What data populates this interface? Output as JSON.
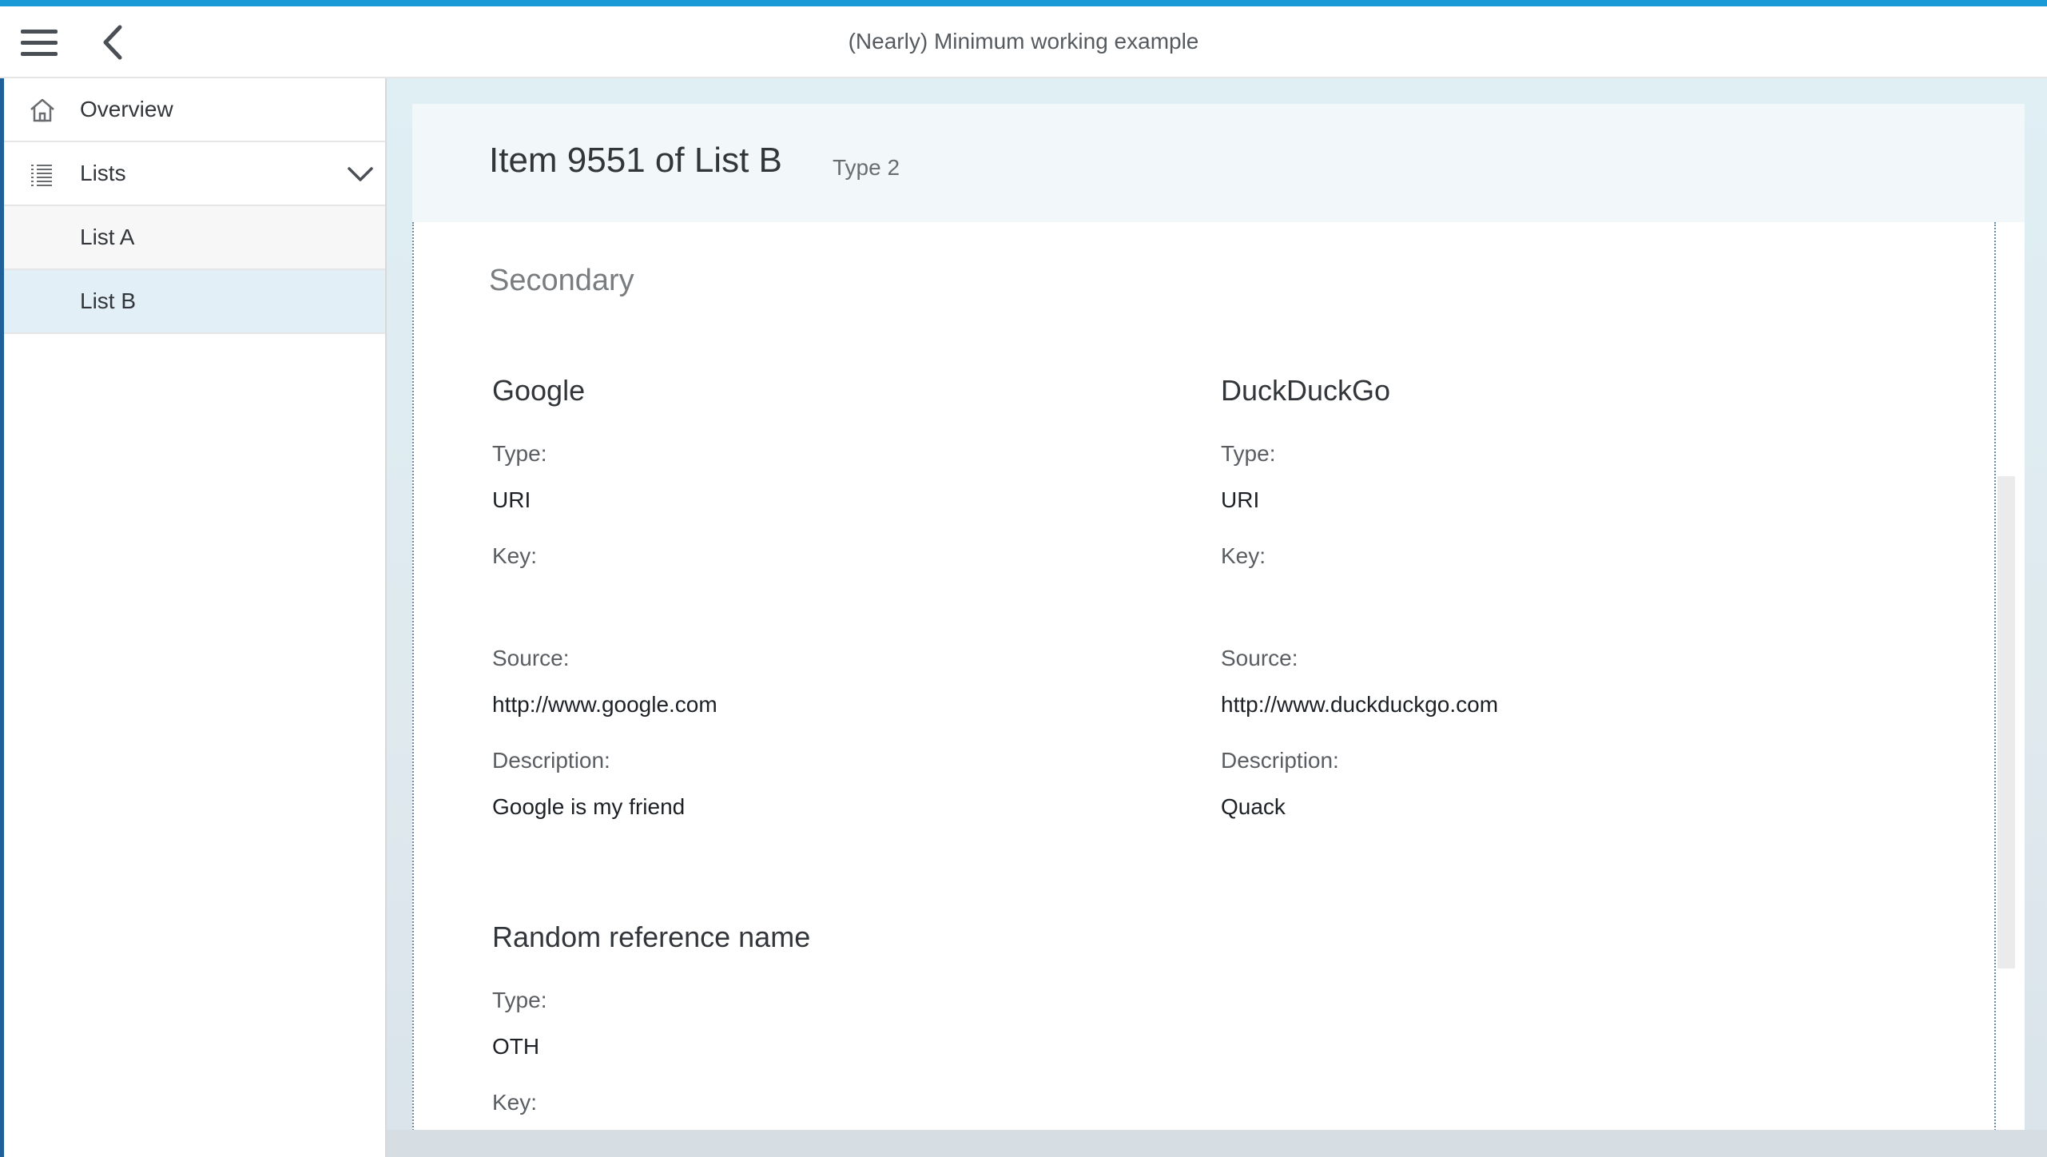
{
  "header": {
    "title": "(Nearly) Minimum working example",
    "menu_icon": "hamburger-icon",
    "back_icon": "chevron-left-icon"
  },
  "sidebar": {
    "items": [
      {
        "label": "Overview",
        "icon": "home-icon"
      },
      {
        "label": "Lists",
        "icon": "list-icon",
        "expanded": true
      },
      {
        "label": "List A"
      },
      {
        "label": "List B",
        "selected": true
      }
    ]
  },
  "page": {
    "title": "Item 9551 of List B",
    "subtitle": "Type 2"
  },
  "section": {
    "title": "Secondary",
    "references": [
      {
        "name": "Google",
        "type_label": "Type:",
        "type_value": "URI",
        "key_label": "Key:",
        "key_value": "",
        "source_label": "Source:",
        "source_value": "http://www.google.com",
        "description_label": "Description:",
        "description_value": "Google is my friend"
      },
      {
        "name": "DuckDuckGo",
        "type_label": "Type:",
        "type_value": "URI",
        "key_label": "Key:",
        "key_value": "",
        "source_label": "Source:",
        "source_value": "http://www.duckduckgo.com",
        "description_label": "Description:",
        "description_value": "Quack"
      },
      {
        "name": "Random reference name",
        "type_label": "Type:",
        "type_value": "OTH",
        "key_label": "Key:"
      }
    ]
  },
  "colors": {
    "accent": "#1a9ad6",
    "selected_bg": "#e2eff7",
    "page_head_bg": "#f2f7fa"
  }
}
